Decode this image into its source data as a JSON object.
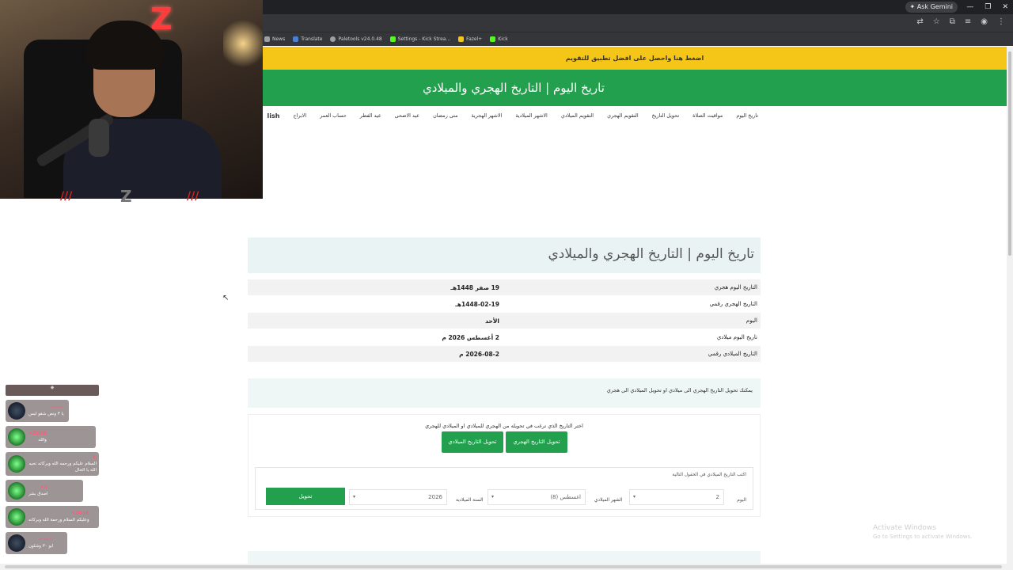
{
  "browser": {
    "ask_gemini": "Ask Gemini",
    "window_buttons": [
      "—",
      "❐",
      "✕"
    ],
    "bookmarks": [
      {
        "label": "News",
        "icon": "news-icon"
      },
      {
        "label": "Translate",
        "icon": "translate-icon"
      },
      {
        "label": "Paletools v24.0.48",
        "icon": "paletools-icon"
      },
      {
        "label": "Settings - Kick Strea...",
        "icon": "kick-icon"
      },
      {
        "label": "Fazel+",
        "icon": "star-icon"
      },
      {
        "label": "Kick",
        "icon": "kick-icon"
      }
    ]
  },
  "promo_banner": "اضغط هنا واحصل على افضل تطبيق للتقويم",
  "header_title": "تاريخ اليوم | التاريخ الهجري والميلادي",
  "nav": [
    "تاريخ اليوم",
    "مواقيت الصلاة",
    "تحويل التاريخ",
    "التقويم الهجري",
    "التقويم الميلادي",
    "الاشهر الميلادية",
    "الاشهر الهجرية",
    "متى رمضان",
    "عيد الاضحى",
    "عيد الفطر",
    "حساب العمر",
    "الابراج"
  ],
  "nav_language": "lish",
  "card_title": "تاريخ اليوم | التاريخ الهجري والميلادي",
  "info_rows": [
    {
      "label": "التاريخ اليوم هجري",
      "value": "19 صفر 1448هـ"
    },
    {
      "label": "التاريخ الهجري رقمي",
      "value": "1448-02-19هـ"
    },
    {
      "label": "اليوم",
      "value": "الأحد"
    },
    {
      "label": "تاريخ اليوم ميلادي",
      "value": "2 أغسطس 2026 م"
    },
    {
      "label": "التاريخ الميلادي رقمي",
      "value": "2026-08-2 م"
    }
  ],
  "note": "يمكنك تحويل التاريخ الهجري الى ميلادي او تحويل الميلادي الى هجري",
  "converter": {
    "question": "اختر التاريخ الذي ترغب في تحويله من الهجري للميلادي او الميلادي للهجري",
    "btn_hijri": "تحويل التاريخ الهجري",
    "btn_gregorian": "تحويل التاريخ الميلادي",
    "form_hint": "اكتب التاريخ الميلادي في الحقول التالية",
    "day_label": "اليوم",
    "day_value": "2",
    "month_label": "الشهر الميلادي",
    "month_value": "(8) اغسطس",
    "year_label": "السنة الميلادية",
    "year_value": "2026",
    "convert_btn": "تحويل"
  },
  "watermark": {
    "title": "Activate Windows",
    "subtitle": "Go to Settings to activate Windows."
  },
  "chat": {
    "messages": [
      {
        "user": "———",
        "text": "يا ٣ ونص شقو ليس",
        "avatar": "dark"
      },
      {
        "user": "ZOSE✦",
        "text": "والله",
        "avatar": "green"
      },
      {
        "user": "♛",
        "text": "السلام عليكم ورحمه الله وبركاته تحيه الله يا الخال",
        "avatar": "green"
      },
      {
        "user": "♛✦",
        "text": "اصدق بشر",
        "avatar": "green"
      },
      {
        "user": "ZOSE✦",
        "text": "وعليكم السلام ورحمة الله وبركاته",
        "avatar": "green"
      },
      {
        "user": "———",
        "text": "ابو ٣٠ وشلون",
        "avatar": "dark"
      }
    ]
  },
  "webcam": {
    "neon_logo": "Z",
    "strip_logo": "Z",
    "strip_marks": "///"
  }
}
